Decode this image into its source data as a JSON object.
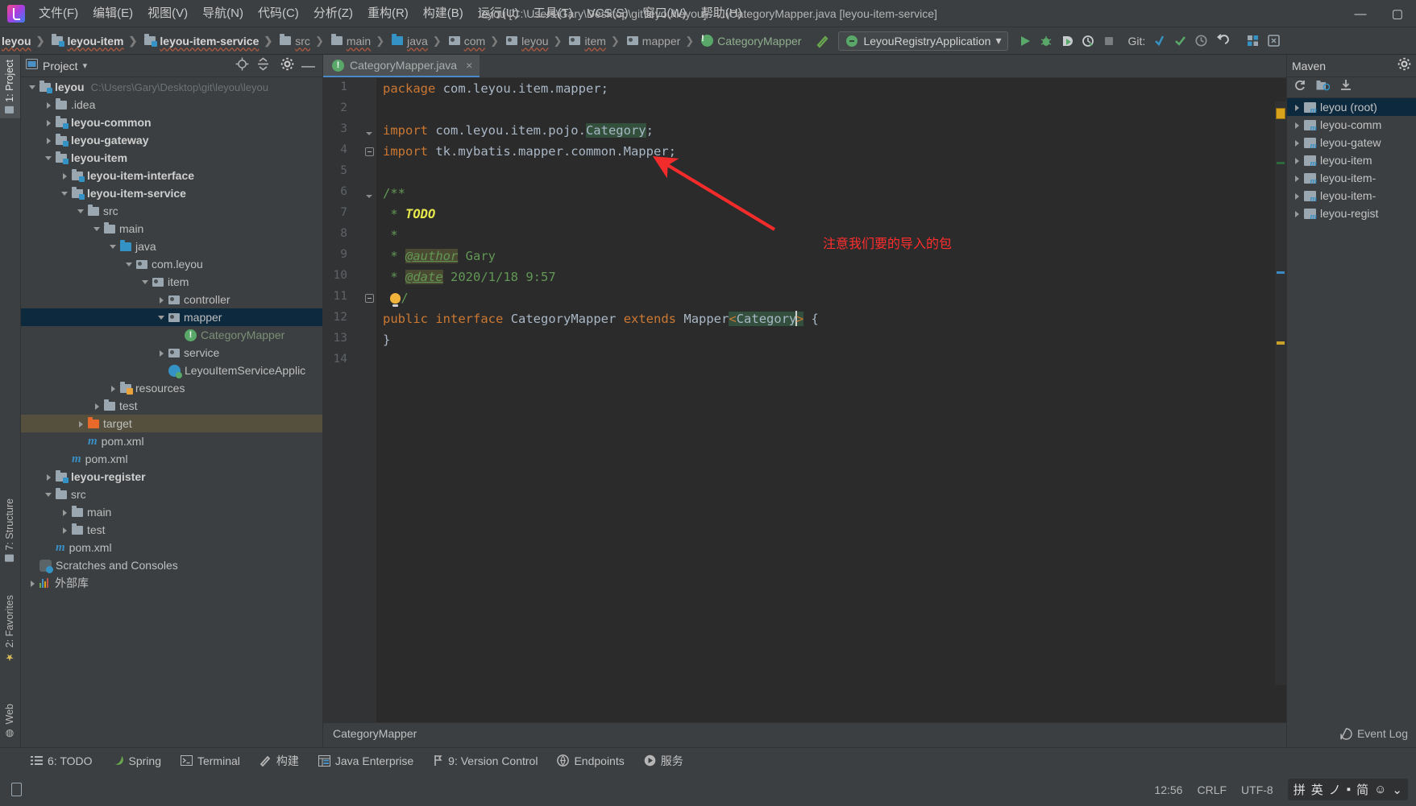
{
  "window": {
    "title": "leyou [C:\\Users\\Gary\\Desktop\\git\\leyou\\leyou] - ...\\CategoryMapper.java [leyou-item-service]",
    "minimize": "—",
    "maximize": "▢"
  },
  "menubar": {
    "logo": "intellij-logo",
    "items": [
      {
        "label": "文件(F)"
      },
      {
        "label": "编辑(E)"
      },
      {
        "label": "视图(V)"
      },
      {
        "label": "导航(N)"
      },
      {
        "label": "代码(C)"
      },
      {
        "label": "分析(Z)"
      },
      {
        "label": "重构(R)"
      },
      {
        "label": "构建(B)"
      },
      {
        "label": "运行(U)"
      },
      {
        "label": "工具(T)"
      },
      {
        "label": "VCS(S)"
      },
      {
        "label": "窗口(W)"
      },
      {
        "label": "帮助(H)"
      }
    ]
  },
  "breadcrumbs": [
    {
      "label": "leyou",
      "icon": "module-icon",
      "bold": true
    },
    {
      "label": "leyou-item",
      "icon": "module-icon",
      "bold": true
    },
    {
      "label": "leyou-item-service",
      "icon": "module-icon",
      "bold": true
    },
    {
      "label": "src",
      "icon": "folder-icon",
      "bold": false
    },
    {
      "label": "main",
      "icon": "folder-icon",
      "bold": false
    },
    {
      "label": "java",
      "icon": "source-folder-icon",
      "bold": false
    },
    {
      "label": "com",
      "icon": "package-icon",
      "bold": false
    },
    {
      "label": "leyou",
      "icon": "package-icon",
      "bold": false
    },
    {
      "label": "item",
      "icon": "package-icon",
      "bold": false
    },
    {
      "label": "mapper",
      "icon": "package-icon",
      "bold": false
    },
    {
      "label": "CategoryMapper",
      "icon": "interface-icon",
      "bold": false
    }
  ],
  "toolbar": {
    "build_icon": "hammer-icon",
    "run_config": "LeyouRegistryApplication",
    "run_config_chevron": "▾",
    "run": "run-icon",
    "debug": "debug-icon",
    "run_coverage": "run-with-coverage-icon",
    "profile": "profiler-icon",
    "stop": "stop-icon",
    "git_label": "Git:",
    "git_update": "update-project-icon",
    "git_commit": "commit-icon",
    "git_history": "history-icon",
    "git_rollback": "rollback-icon",
    "structure_btn": "structure-icon",
    "search_btn": "search-everywhere-icon"
  },
  "left_strip": {
    "tabs": [
      {
        "label": "1: Project",
        "icon": "project-icon",
        "active": true
      },
      {
        "label": "7: Structure",
        "icon": "structure-icon",
        "active": false
      },
      {
        "label": "2: Favorites",
        "icon": "star-icon",
        "active": false
      },
      {
        "label": "Web",
        "icon": "web-icon",
        "active": false
      }
    ]
  },
  "project_panel": {
    "title": "Project",
    "chevron": "▾",
    "icons": {
      "locate": "locate-icon",
      "collapse": "collapse-all-icon",
      "settings": "gear-icon",
      "hide": "hide-icon"
    },
    "tree": [
      {
        "label": "leyou",
        "path": "C:\\Users\\Gary\\Desktop\\git\\leyou\\leyou",
        "indent": 0,
        "arrow": "down",
        "icon": "module-icon",
        "bold": true
      },
      {
        "label": ".idea",
        "indent": 1,
        "arrow": "right",
        "icon": "folder-icon",
        "bold": false
      },
      {
        "label": "leyou-common",
        "indent": 1,
        "arrow": "right",
        "icon": "module-icon",
        "bold": true
      },
      {
        "label": "leyou-gateway",
        "indent": 1,
        "arrow": "right",
        "icon": "module-icon",
        "bold": true
      },
      {
        "label": "leyou-item",
        "indent": 1,
        "arrow": "down",
        "icon": "module-icon",
        "bold": true
      },
      {
        "label": "leyou-item-interface",
        "indent": 2,
        "arrow": "right",
        "icon": "module-icon",
        "bold": true
      },
      {
        "label": "leyou-item-service",
        "indent": 2,
        "arrow": "down",
        "icon": "module-icon",
        "bold": true
      },
      {
        "label": "src",
        "indent": 3,
        "arrow": "down",
        "icon": "folder-icon",
        "bold": false
      },
      {
        "label": "main",
        "indent": 4,
        "arrow": "down",
        "icon": "folder-icon",
        "bold": false
      },
      {
        "label": "java",
        "indent": 5,
        "arrow": "down",
        "icon": "source-folder-icon",
        "bold": false
      },
      {
        "label": "com.leyou",
        "indent": 6,
        "arrow": "down",
        "icon": "package-icon",
        "bold": false
      },
      {
        "label": "item",
        "indent": 7,
        "arrow": "down",
        "icon": "package-icon",
        "bold": false
      },
      {
        "label": "controller",
        "indent": 8,
        "arrow": "right",
        "icon": "package-icon",
        "bold": false
      },
      {
        "label": "mapper",
        "indent": 8,
        "arrow": "down",
        "icon": "package-icon",
        "bold": false,
        "selected": true
      },
      {
        "label": "CategoryMapper",
        "indent": 9,
        "arrow": "none",
        "icon": "interface-icon",
        "bold": false,
        "dim": true
      },
      {
        "label": "service",
        "indent": 8,
        "arrow": "right",
        "icon": "package-icon",
        "bold": false
      },
      {
        "label": "LeyouItemServiceApplic",
        "indent": 8,
        "arrow": "none",
        "icon": "spring-class-icon",
        "bold": false
      },
      {
        "label": "resources",
        "indent": 5,
        "arrow": "right",
        "icon": "resources-folder-icon",
        "bold": false
      },
      {
        "label": "test",
        "indent": 4,
        "arrow": "right",
        "icon": "folder-icon",
        "bold": false
      },
      {
        "label": "target",
        "indent": 3,
        "arrow": "right",
        "icon": "excluded-folder-icon",
        "bold": false,
        "target": true
      },
      {
        "label": "pom.xml",
        "indent": 3,
        "arrow": "none",
        "icon": "maven-file-icon",
        "bold": false
      },
      {
        "label": "pom.xml",
        "indent": 2,
        "arrow": "none",
        "icon": "maven-file-icon",
        "bold": false
      },
      {
        "label": "leyou-register",
        "indent": 1,
        "arrow": "right",
        "icon": "module-icon",
        "bold": true
      },
      {
        "label": "src",
        "indent": 1,
        "arrow": "down",
        "icon": "folder-icon",
        "bold": false
      },
      {
        "label": "main",
        "indent": 2,
        "arrow": "right",
        "icon": "folder-icon",
        "bold": false
      },
      {
        "label": "test",
        "indent": 2,
        "arrow": "right",
        "icon": "folder-icon",
        "bold": false
      },
      {
        "label": "pom.xml",
        "indent": 1,
        "arrow": "none",
        "icon": "maven-file-icon",
        "bold": false
      },
      {
        "label": "Scratches and Consoles",
        "indent": 0,
        "arrow": "none",
        "icon": "scratches-icon",
        "bold": false
      },
      {
        "label": "外部库",
        "indent": 0,
        "arrow": "right",
        "icon": "library-icon",
        "bold": false
      }
    ]
  },
  "editor": {
    "tab": {
      "label": "CategoryMapper.java",
      "icon": "interface-icon",
      "close": "×"
    },
    "breadcrumb_bottom": "CategoryMapper",
    "lines": [
      {
        "n": "1",
        "fold": "none"
      },
      {
        "n": "2",
        "fold": "none"
      },
      {
        "n": "3",
        "fold": "dtri"
      },
      {
        "n": "4",
        "fold": "minus"
      },
      {
        "n": "5",
        "fold": "none"
      },
      {
        "n": "6",
        "fold": "dtri"
      },
      {
        "n": "7",
        "fold": "none"
      },
      {
        "n": "8",
        "fold": "none"
      },
      {
        "n": "9",
        "fold": "none"
      },
      {
        "n": "10",
        "fold": "none"
      },
      {
        "n": "11",
        "fold": "minus"
      },
      {
        "n": "12",
        "fold": "none"
      },
      {
        "n": "13",
        "fold": "none"
      },
      {
        "n": "14",
        "fold": "none"
      }
    ],
    "code": {
      "l1_kw": "package",
      "l1_rest": " com.leyou.item.mapper;",
      "l3_kw": "import",
      "l3_a": " com.leyou.item.pojo.",
      "l3_hl": "Category",
      "l3_end": ";",
      "l4_kw": "import",
      "l4_rest": " tk.mybatis.mapper.common.Mapper;",
      "l6": "/**",
      "l7_star": " * ",
      "l7_todo": "TODO",
      "l8": " *",
      "l9_star": " * ",
      "l9_tag": "@author",
      "l9_rest": " Gary",
      "l10_star": " * ",
      "l10_tag": "@date",
      "l10_rest": " 2020/1/18 9:57",
      "l11_slash": "/",
      "l12_kw1": "public",
      "l12_kw2": "interface",
      "l12_name": "CategoryMapper",
      "l12_kw3": "extends",
      "l12_mapper": "Mapper",
      "l12_generic": "<Category>",
      "l12_brace": " {",
      "l13": "}"
    },
    "annotation": {
      "text": "注意我们要的导入的包",
      "color": "#ff2d2d",
      "arrow": "red-arrow"
    }
  },
  "maven_panel": {
    "title": "Maven",
    "gear": "gear-icon",
    "tools": {
      "reload": "reload-icon",
      "add": "add-maven-project-icon",
      "download": "download-sources-icon"
    },
    "tree": [
      {
        "label": "leyou (root)",
        "selected": true
      },
      {
        "label": "leyou-comm",
        "selected": false
      },
      {
        "label": "leyou-gatew",
        "selected": false
      },
      {
        "label": "leyou-item",
        "selected": false
      },
      {
        "label": "leyou-item-",
        "selected": false
      },
      {
        "label": "leyou-item-",
        "selected": false
      },
      {
        "label": "leyou-regist",
        "selected": false
      }
    ]
  },
  "tool_window_bar": {
    "items": [
      {
        "label": "6: TODO",
        "icon": "todo-icon",
        "key": "6"
      },
      {
        "label": "Spring",
        "icon": "spring-icon",
        "key": ""
      },
      {
        "label": "Terminal",
        "icon": "terminal-icon",
        "key": ""
      },
      {
        "label": "构建",
        "icon": "build-icon",
        "key": ""
      },
      {
        "label": "Java Enterprise",
        "icon": "javaee-icon",
        "key": ""
      },
      {
        "label": "9: Version Control",
        "icon": "vcs-icon",
        "key": "9"
      },
      {
        "label": "Endpoints",
        "icon": "endpoints-icon",
        "key": ""
      },
      {
        "label": "服务",
        "icon": "services-icon",
        "key": ""
      }
    ]
  },
  "status_bar": {
    "event_log": "Event Log",
    "event_log_icon": "event-log-icon",
    "position": "12:56",
    "line_separator": "CRLF",
    "encoding": "UTF-8",
    "ime": [
      "拼",
      "英",
      "ノ",
      "▪",
      "简",
      "☺",
      "⌄"
    ],
    "phone_icon": "device-icon"
  }
}
